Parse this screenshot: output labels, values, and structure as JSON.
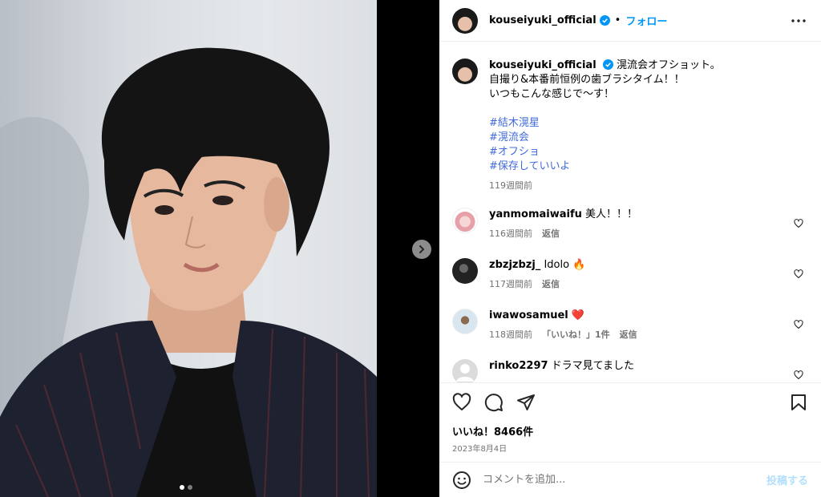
{
  "post": {
    "username": "kouseiyuki_official",
    "separator": "•",
    "follow_label": "フォロー",
    "caption": {
      "first_line": "滉流会オフショット。",
      "lines": [
        "自撮り&本番前恒例の歯ブラシタイム！！",
        "いつもこんな感じで〜す！"
      ],
      "hashtags": [
        "#結木滉星",
        "#滉流会",
        "#オフショ",
        "#保存していいよ"
      ],
      "time": "119週間前"
    }
  },
  "comments": [
    {
      "username": "yanmomaiwaifu",
      "text": "美人！！！",
      "time": "116週間前",
      "likes": "",
      "reply": "返信"
    },
    {
      "username": "zbzjzbzj_",
      "text": "Idolo 🔥",
      "time": "117週間前",
      "likes": "",
      "reply": "返信"
    },
    {
      "username": "iwawosamuel",
      "text": "❤️",
      "time": "118週間前",
      "likes": "「いいね！」1件",
      "reply": "返信"
    },
    {
      "username": "rinko2297",
      "text": "ドラマ見てました",
      "time": "",
      "likes": "",
      "reply": ""
    }
  ],
  "footer": {
    "likes": "いいね！8466件",
    "date": "2023年8月4日",
    "comment_placeholder": "コメントを追加...",
    "post_label": "投稿する"
  },
  "colors": {
    "accent": "#0095f6",
    "hashtag": "#3f6ad8",
    "muted": "#737373",
    "heart_red": "#ed4956"
  },
  "icons": [
    "verified-badge-icon",
    "more-options-icon",
    "heart-icon",
    "comment-icon",
    "share-icon",
    "bookmark-icon",
    "emoji-icon",
    "chevron-right-icon"
  ]
}
